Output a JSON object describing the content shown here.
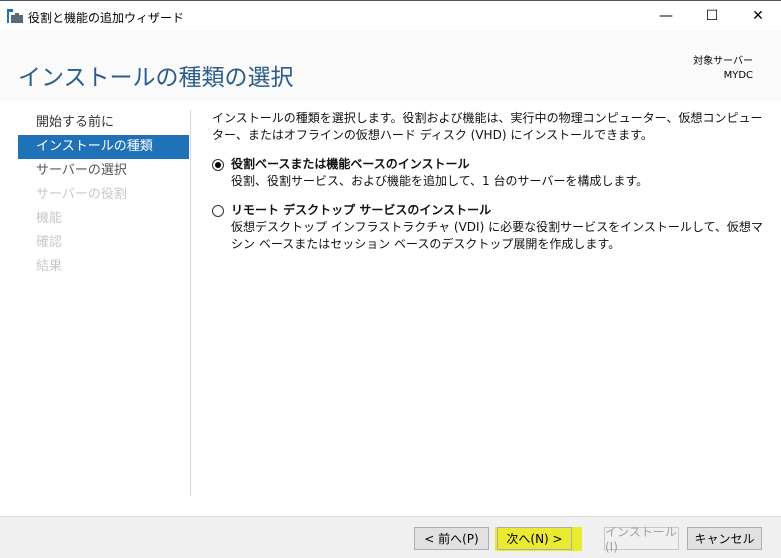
{
  "window": {
    "title": "役割と機能の追加ウィザード",
    "minimize": "—",
    "maximize": "☐",
    "close": "✕"
  },
  "header": {
    "title": "インストールの種類の選択",
    "target_label": "対象サーバー",
    "target_server": "MYDC"
  },
  "nav": {
    "items": [
      {
        "label": "開始する前に",
        "state": "done"
      },
      {
        "label": "インストールの種類",
        "state": "selected"
      },
      {
        "label": "サーバーの選択",
        "state": "next"
      },
      {
        "label": "サーバーの役割",
        "state": "disabled"
      },
      {
        "label": "機能",
        "state": "disabled"
      },
      {
        "label": "確認",
        "state": "disabled"
      },
      {
        "label": "結果",
        "state": "disabled"
      }
    ]
  },
  "content": {
    "intro": "インストールの種類を選択します。役割および機能は、実行中の物理コンピューター、仮想コンピューター、またはオフラインの仮想ハード ディスク (VHD) にインストールできます。",
    "options": [
      {
        "label": "役割ベースまたは機能ベースのインストール",
        "description": "役割、役割サービス、および機能を追加して、1 台のサーバーを構成します。",
        "selected": true
      },
      {
        "label": "リモート デスクトップ サービスのインストール",
        "description": "仮想デスクトップ インフラストラクチャ (VDI) に必要な役割サービスをインストールして、仮想マシン ベースまたはセッション ベースのデスクトップ展開を作成します。",
        "selected": false
      }
    ]
  },
  "footer": {
    "prev": "< 前へ(P)",
    "next": "次へ(N) >",
    "install": "インストール(I)",
    "cancel": "キャンセル"
  },
  "colors": {
    "accent": "#1f72b8",
    "title": "#2b5d8a",
    "highlight": "#e8e800"
  }
}
